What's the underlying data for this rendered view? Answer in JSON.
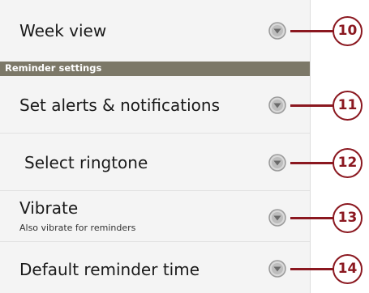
{
  "section_header": "Reminder settings",
  "rows": [
    {
      "label": "Week view",
      "callout": "10"
    },
    {
      "label": "Set alerts & notifications",
      "callout": "11"
    },
    {
      "label": "Select ringtone",
      "callout": "12"
    },
    {
      "label": "Vibrate",
      "sublabel": "Also vibrate for reminders",
      "callout": "13"
    },
    {
      "label": "Default reminder time",
      "callout": "14"
    }
  ],
  "icons": {
    "dropdown": "chevron-down-circle-icon"
  },
  "colors": {
    "accent": "#8b1820",
    "section_header_bg": "#7c7868",
    "background": "#f4f4f4"
  }
}
